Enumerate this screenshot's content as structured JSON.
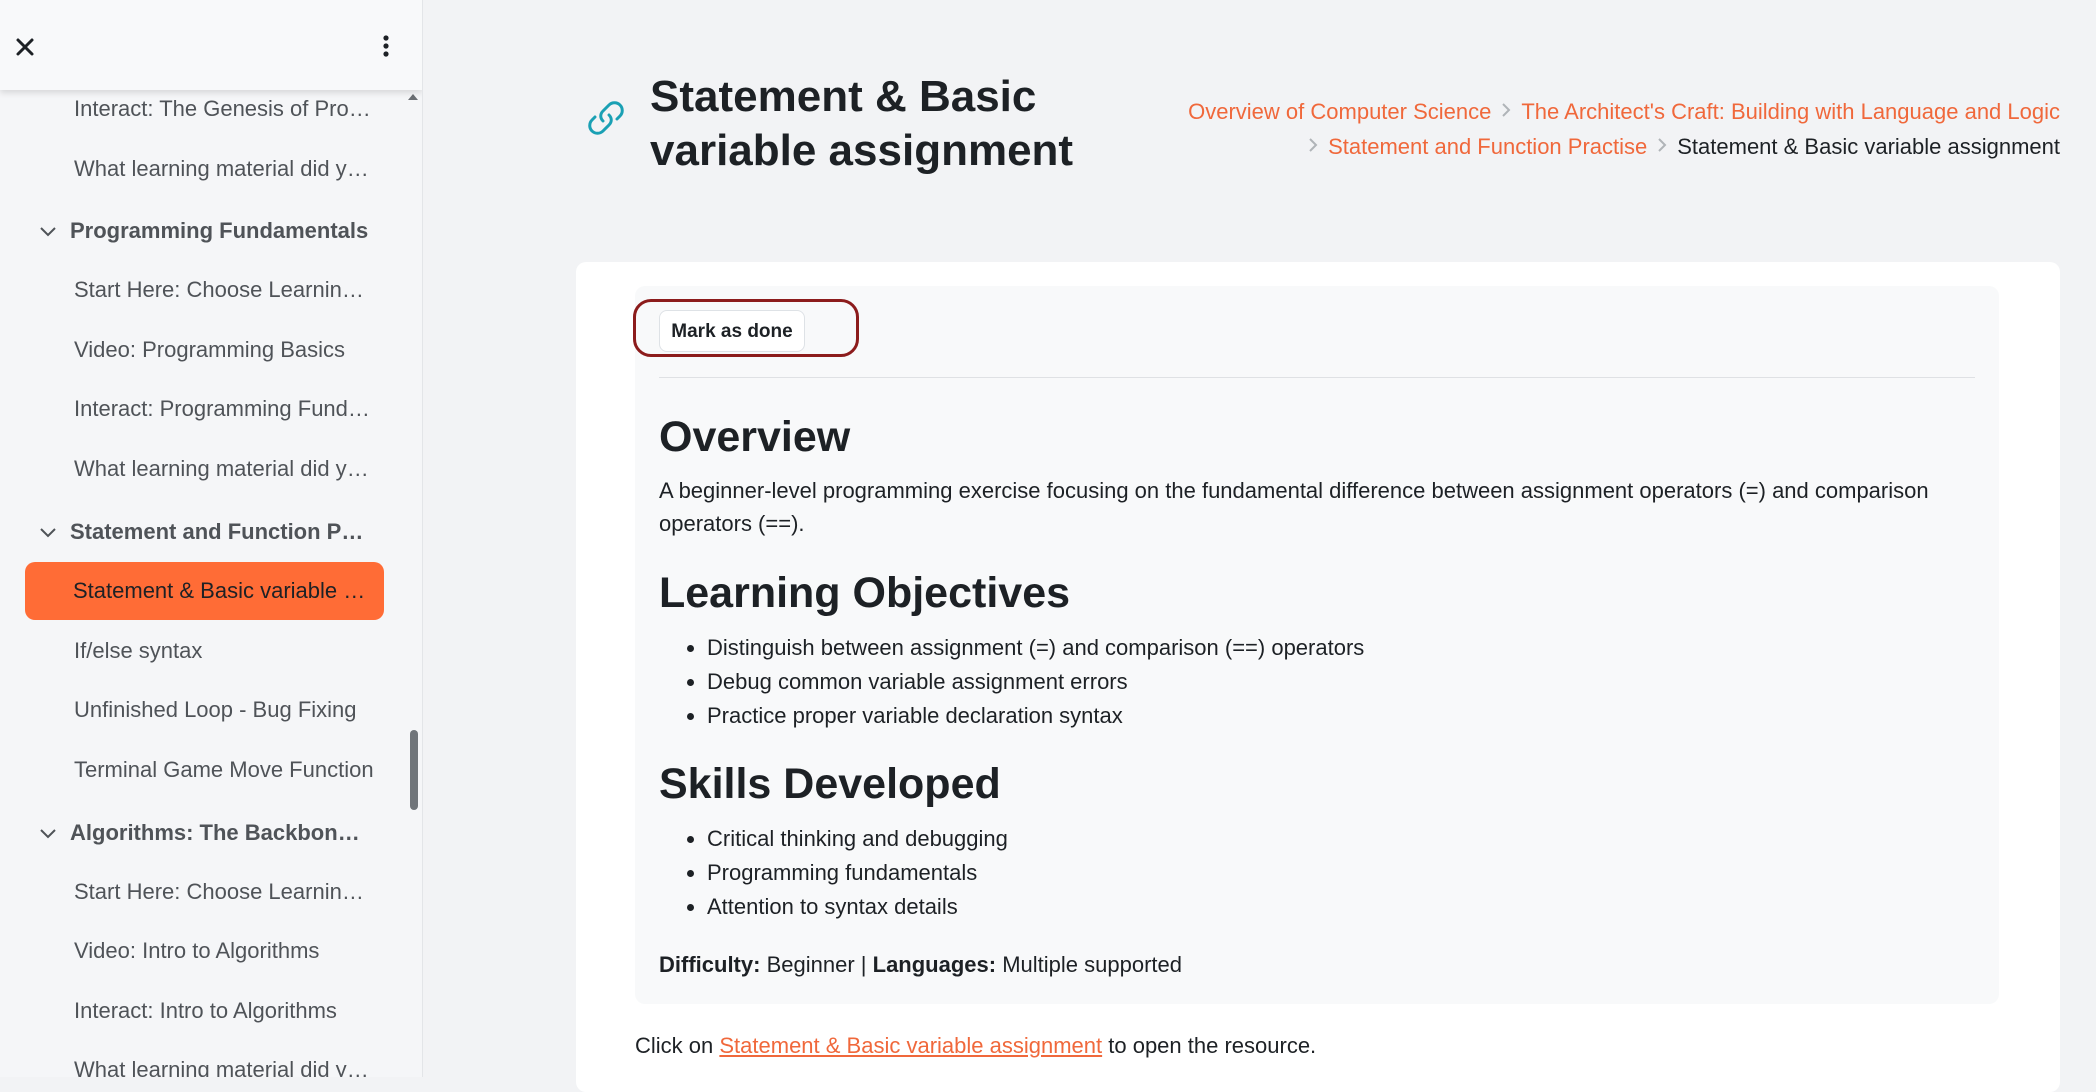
{
  "sidebar": {
    "close_icon": "close-icon",
    "menu_icon": "kebab-menu-icon",
    "items": [
      {
        "label": "Interact: The Genesis of Programming",
        "kind": "item"
      },
      {
        "label": "What learning material did you find helpful?",
        "kind": "item"
      },
      {
        "label": "Programming Fundamentals",
        "kind": "section"
      },
      {
        "label": "Start Here: Choose Learning Path",
        "kind": "item"
      },
      {
        "label": "Video: Programming Basics",
        "kind": "item"
      },
      {
        "label": "Interact: Programming Fundamentals",
        "kind": "item"
      },
      {
        "label": "What learning material did you find helpful?",
        "kind": "item"
      },
      {
        "label": "Statement and Function Practise",
        "kind": "section"
      },
      {
        "label": "Statement & Basic variable assignment",
        "kind": "active"
      },
      {
        "label": "If/else syntax",
        "kind": "item"
      },
      {
        "label": "Unfinished Loop - Bug Fixing",
        "kind": "item"
      },
      {
        "label": "Terminal Game Move Function",
        "kind": "item"
      },
      {
        "label": "Algorithms: The Backbone of Computing",
        "kind": "section"
      },
      {
        "label": "Start Here: Choose Learning Path",
        "kind": "item"
      },
      {
        "label": "Video: Intro to Algorithms",
        "kind": "item"
      },
      {
        "label": "Interact: Intro to Algorithms",
        "kind": "item"
      },
      {
        "label": "What learning material did you find helpful?",
        "kind": "item"
      }
    ]
  },
  "header": {
    "title": "Statement & Basic variable assignment",
    "breadcrumb": {
      "items": [
        "Overview of Computer Science",
        "The Architect's Craft: Building with Language and Logic",
        "Statement and Function Practise"
      ],
      "current": "Statement & Basic variable assignment"
    }
  },
  "activity": {
    "mark_done_label": "Mark as done",
    "overview_heading": "Overview",
    "overview_text": "A beginner-level programming exercise focusing on the fundamental difference between assignment operators (=) and comparison operators (==).",
    "objectives_heading": "Learning Objectives",
    "objectives": [
      "Distinguish between assignment (=) and comparison (==) operators",
      "Debug common variable assignment errors",
      "Practice proper variable declaration syntax"
    ],
    "skills_heading": "Skills Developed",
    "skills": [
      "Critical thinking and debugging",
      "Programming fundamentals",
      "Attention to syntax details"
    ],
    "difficulty_label": "Difficulty:",
    "difficulty_value": "Beginner",
    "separator": "|",
    "languages_label": "Languages:",
    "languages_value": "Multiple supported",
    "click_prefix": "Click on",
    "resource_link": "Statement & Basic variable assignment",
    "click_suffix": "to open the resource."
  },
  "colors": {
    "accent": "#ff6c36",
    "link": "#f0683b",
    "highlight_ring": "#8c1c1c",
    "icon_teal": "#1aa0b4"
  }
}
